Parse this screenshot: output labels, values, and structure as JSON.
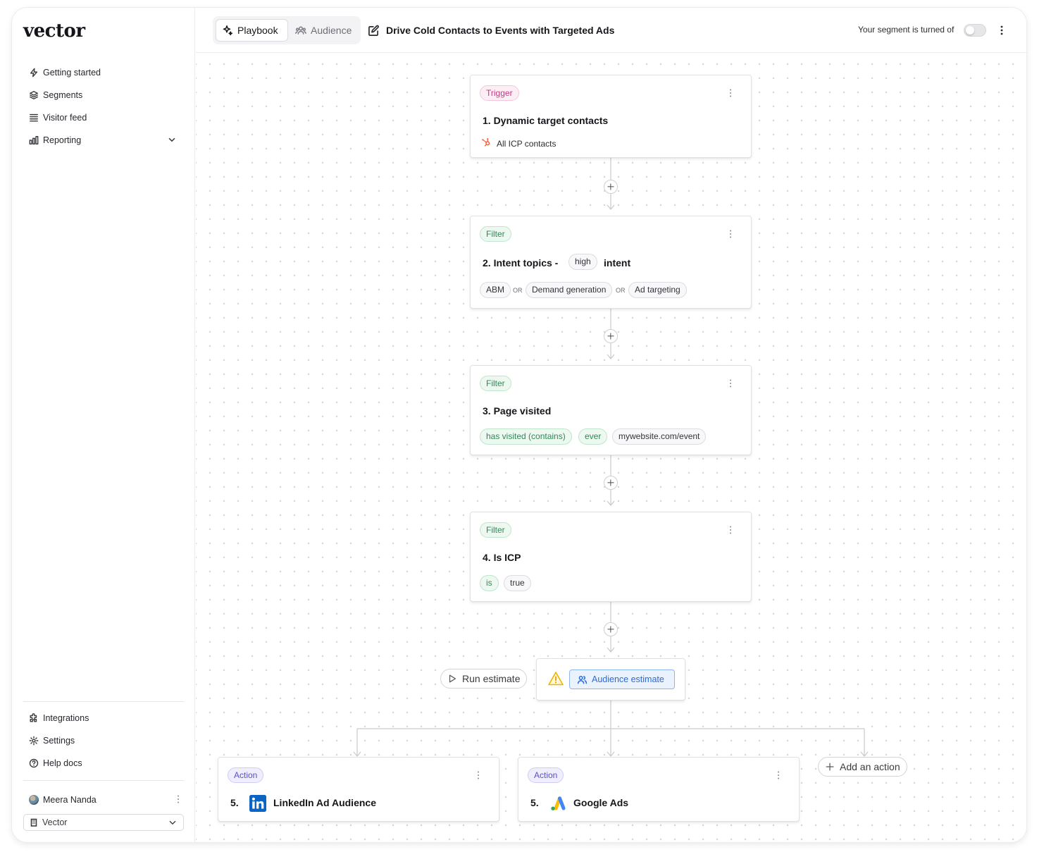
{
  "sidebar": {
    "logo": "vector",
    "nav": {
      "getting_started": "Getting started",
      "segments": "Segments",
      "visitor_feed": "Visitor feed",
      "reporting": "Reporting"
    },
    "bottom": {
      "integrations": "Integrations",
      "settings": "Settings",
      "help_docs": "Help docs"
    },
    "user_name": "Meera Nanda",
    "workspace": "Vector"
  },
  "topbar": {
    "tabs": {
      "playbook": "Playbook",
      "audience": "Audience"
    },
    "title": "Drive Cold Contacts to Events with Targeted Ads",
    "status_text": "Your segment is turned of",
    "segment_enabled": false
  },
  "flow": {
    "step1": {
      "badge": "Trigger",
      "title": "1. Dynamic target contacts",
      "source": "All ICP contacts",
      "source_icon": "hubspot-icon"
    },
    "step2": {
      "badge": "Filter",
      "title_prefix": "2. Intent topics -",
      "level": "high",
      "title_suffix": "intent",
      "topics": [
        "ABM",
        "Demand generation",
        "Ad targeting"
      ],
      "joiner": "OR"
    },
    "step3": {
      "badge": "Filter",
      "title": "3. Page visited",
      "condition": "has visited (contains)",
      "frequency": "ever",
      "url": "mywebsite.com/event"
    },
    "step4": {
      "badge": "Filter",
      "title": "4. Is ICP",
      "operator": "is",
      "value": "true"
    },
    "run_estimate": "Run estimate",
    "audience_estimate": "Audience estimate",
    "actions": [
      {
        "badge": "Action",
        "step": "5.",
        "name": "LinkedIn Ad Audience",
        "icon": "linkedin-icon"
      },
      {
        "badge": "Action",
        "step": "5.",
        "name": "Google Ads",
        "icon": "google-ads-icon"
      }
    ],
    "add_action": "Add an action"
  },
  "colors": {
    "trigger": "#c43a87",
    "filter": "#2f8a55",
    "action": "#5a4fcf",
    "estimate": "#2a6ad6",
    "warning": "#f0b400",
    "linkedin": "#0a66c2"
  }
}
